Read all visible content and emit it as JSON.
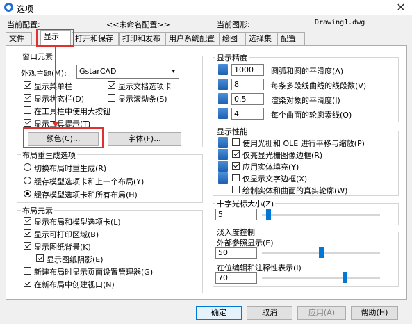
{
  "window": {
    "title": "选项"
  },
  "header": {
    "current_profile_label": "当前配置:",
    "current_profile_value": "<<未命名配置>>",
    "current_drawing_label": "当前图形:",
    "current_drawing_value": "Drawing1.dwg"
  },
  "tabs": [
    "文件",
    "显示",
    "打开和保存",
    "打印和发布",
    "用户系统配置",
    "绘图",
    "选择集",
    "配置"
  ],
  "window_elements": {
    "title": "窗口元素",
    "theme_label": "外观主题(M):",
    "theme_value": "GstarCAD",
    "cb_menubar": "显示菜单栏",
    "cb_doctabs": "显示文档选项卡",
    "cb_statusbar": "显示状态栏(D)",
    "cb_scrollbars": "显示滚动条(S)",
    "cb_largebuttons": "在工具栏中使用大按钮",
    "cb_tooltips": "显示工具提示(T)",
    "btn_color": "颜色(C)...",
    "btn_font": "字体(F)..."
  },
  "layout_regen": {
    "title": "布局重生成选项",
    "r1": "切换布局时重生成(R)",
    "r2": "缓存模型选项卡和上一个布局(Y)",
    "r3": "缓存模型选项卡和所有布局(H)"
  },
  "layout_elements": {
    "title": "布局元素",
    "c1": "显示布局和模型选项卡(L)",
    "c2": "显示可打印区域(B)",
    "c3": "显示图纸背景(K)",
    "c4": "显示图纸阴影(E)",
    "c5": "新建布局时显示页面设置管理器(G)",
    "c6": "在新布局中创建视口(N)"
  },
  "display_resolution": {
    "title": "显示精度",
    "items": [
      {
        "value": "1000",
        "label": "圆弧和圆的平滑度(A)"
      },
      {
        "value": "8",
        "label": "每条多段线曲线的线段数(V)"
      },
      {
        "value": "0.5",
        "label": "渲染对象的平滑度(J)"
      },
      {
        "value": "4",
        "label": "每个曲面的轮廓素线(O)"
      }
    ]
  },
  "display_performance": {
    "title": "显示性能",
    "p1": "使用光栅和 OLE 进行平移与缩放(P)",
    "p2": "仅亮显光栅图像边框(R)",
    "p3": "应用实体填充(Y)",
    "p4": "仅显示文字边框(X)",
    "p5": "绘制实体和曲面的真实轮廓(W)"
  },
  "crosshair": {
    "title": "十字光标大小(Z)",
    "value": "5",
    "level_percent": 5
  },
  "fade": {
    "title": "淡入度控制",
    "xref_label": "外部参照显示(E)",
    "xref_value": "50",
    "xref_level_percent": 50,
    "inplace_label": "在位编辑和注释性表示(I)",
    "inplace_value": "70",
    "inplace_level_percent": 70
  },
  "footer": {
    "ok": "确定",
    "cancel": "取消",
    "apply": "应用(A)",
    "help": "帮助(H)"
  },
  "colors": {
    "accent": "#0078d7",
    "highlight": "#e03030"
  }
}
